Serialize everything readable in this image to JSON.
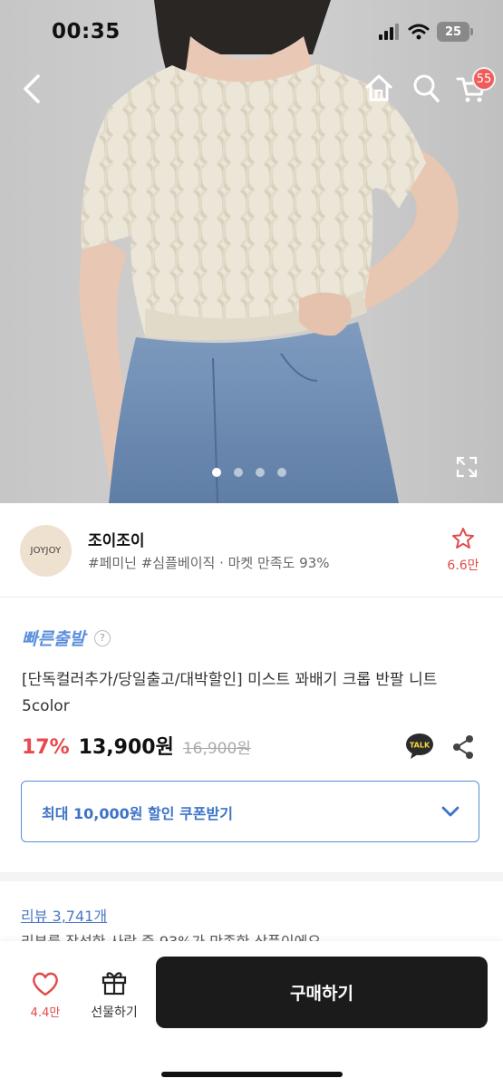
{
  "status_bar": {
    "time": "00:35",
    "battery": "25"
  },
  "colors": {
    "accent_blue": "#5b8fdb",
    "discount_red": "#e8494f",
    "badge_red": "#f15b5b",
    "buy_button": "#1b1b1b"
  },
  "nav": {
    "icons": [
      "back-icon",
      "home-icon",
      "search-icon",
      "cart-icon"
    ],
    "cart_badge": "55"
  },
  "gallery": {
    "image_count": 4,
    "active_index": 0
  },
  "seller": {
    "logo_text": "JOYJOY",
    "name": "조이조이",
    "meta": "#페미닌 #심플베이직 · 마켓 만족도 93%",
    "favorite_count": "6.6만"
  },
  "product": {
    "shipping_label": "빠른출발",
    "help": "?",
    "title": "[단독컬러추가/당일출고/대박할인] 미스트 꽈배기 크롭 반팔 니트 5color",
    "discount": "17%",
    "price": "13,900원",
    "original_price": "16,900원",
    "talk_label": "TALK"
  },
  "coupon": {
    "label": "최대 10,000원 할인 쿠폰받기"
  },
  "reviews": {
    "link": "리뷰 3,741개",
    "snippet": "리뷰를 작성한 사람 중 93%가 만족한 상품이에요"
  },
  "bottom_bar": {
    "like_count": "4.4만",
    "gift_label": "선물하기",
    "buy_label": "구매하기"
  }
}
